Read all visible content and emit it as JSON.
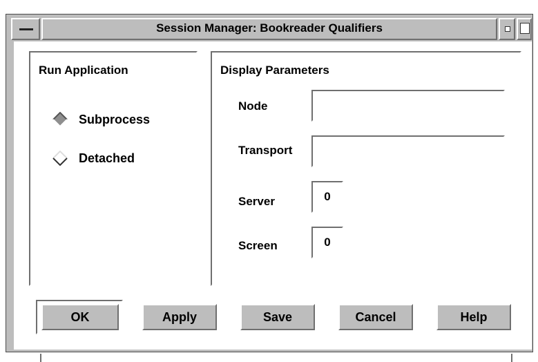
{
  "window": {
    "title": "Session Manager: Bookreader Qualifiers"
  },
  "run_application": {
    "title": "Run Application",
    "options": [
      {
        "label": "Subprocess",
        "selected": true
      },
      {
        "label": "Detached",
        "selected": false
      }
    ]
  },
  "display_parameters": {
    "title": "Display Parameters",
    "node": {
      "label": "Node",
      "value": ""
    },
    "transport": {
      "label": "Transport",
      "value": ""
    },
    "server": {
      "label": "Server",
      "value": "0"
    },
    "screen": {
      "label": "Screen",
      "value": "0"
    }
  },
  "buttons": {
    "ok": "OK",
    "apply": "Apply",
    "save": "Save",
    "cancel": "Cancel",
    "help": "Help"
  },
  "colors": {
    "face": "#bdbdbd",
    "radio_selected": "#8f8f8f"
  },
  "icons": [
    "window-menu-icon",
    "minimize-icon",
    "maximize-icon",
    "radio-diamond-icon"
  ]
}
